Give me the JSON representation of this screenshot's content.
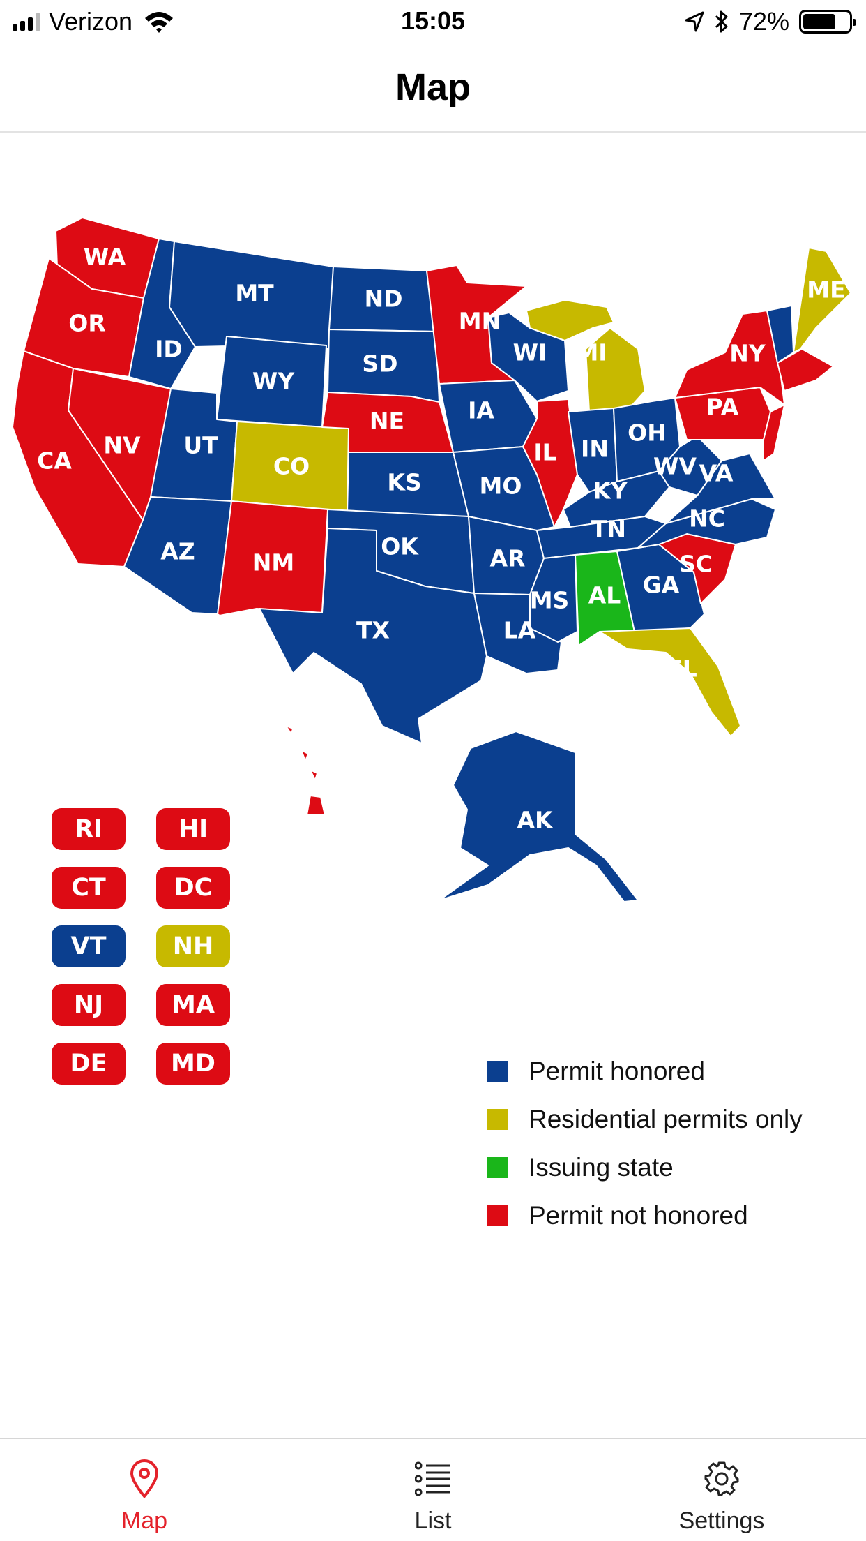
{
  "status_bar": {
    "carrier": "Verizon",
    "time": "15:05",
    "battery_percent": "72%",
    "battery_level": 0.72,
    "icons": [
      "signal-icon",
      "wifi-icon",
      "location-arrow-icon",
      "bluetooth-icon",
      "battery-icon"
    ]
  },
  "nav": {
    "title": "Map"
  },
  "colors": {
    "honored": "#0b3f8f",
    "residential": "#c7b900",
    "issuing": "#1ab61a",
    "not_honored": "#dd0b14",
    "tab_active": "#e4222b",
    "tab_inactive": "#222222"
  },
  "map": {
    "states": [
      {
        "abbr": "WA",
        "status": "not_honored"
      },
      {
        "abbr": "OR",
        "status": "not_honored"
      },
      {
        "abbr": "CA",
        "status": "not_honored"
      },
      {
        "abbr": "NV",
        "status": "not_honored"
      },
      {
        "abbr": "ID",
        "status": "honored"
      },
      {
        "abbr": "MT",
        "status": "honored"
      },
      {
        "abbr": "WY",
        "status": "honored"
      },
      {
        "abbr": "UT",
        "status": "honored"
      },
      {
        "abbr": "AZ",
        "status": "honored"
      },
      {
        "abbr": "CO",
        "status": "residential"
      },
      {
        "abbr": "NM",
        "status": "not_honored"
      },
      {
        "abbr": "ND",
        "status": "honored"
      },
      {
        "abbr": "SD",
        "status": "honored"
      },
      {
        "abbr": "NE",
        "status": "not_honored"
      },
      {
        "abbr": "KS",
        "status": "honored"
      },
      {
        "abbr": "OK",
        "status": "honored"
      },
      {
        "abbr": "TX",
        "status": "honored"
      },
      {
        "abbr": "MN",
        "status": "not_honored"
      },
      {
        "abbr": "IA",
        "status": "honored"
      },
      {
        "abbr": "MO",
        "status": "honored"
      },
      {
        "abbr": "AR",
        "status": "honored"
      },
      {
        "abbr": "LA",
        "status": "honored"
      },
      {
        "abbr": "WI",
        "status": "honored"
      },
      {
        "abbr": "MI",
        "status": "residential"
      },
      {
        "abbr": "IL",
        "status": "not_honored"
      },
      {
        "abbr": "IN",
        "status": "honored"
      },
      {
        "abbr": "OH",
        "status": "honored"
      },
      {
        "abbr": "KY",
        "status": "honored"
      },
      {
        "abbr": "TN",
        "status": "honored"
      },
      {
        "abbr": "MS",
        "status": "honored"
      },
      {
        "abbr": "AL",
        "status": "issuing"
      },
      {
        "abbr": "GA",
        "status": "honored"
      },
      {
        "abbr": "FL",
        "status": "residential"
      },
      {
        "abbr": "SC",
        "status": "not_honored"
      },
      {
        "abbr": "NC",
        "status": "honored"
      },
      {
        "abbr": "VA",
        "status": "honored"
      },
      {
        "abbr": "WV",
        "status": "honored"
      },
      {
        "abbr": "PA",
        "status": "not_honored"
      },
      {
        "abbr": "NY",
        "status": "not_honored"
      },
      {
        "abbr": "ME",
        "status": "residential"
      },
      {
        "abbr": "AK",
        "status": "honored"
      },
      {
        "abbr": "HI",
        "status": "not_honored"
      }
    ],
    "badges": [
      {
        "abbr": "RI",
        "status": "not_honored"
      },
      {
        "abbr": "HI",
        "status": "not_honored"
      },
      {
        "abbr": "CT",
        "status": "not_honored"
      },
      {
        "abbr": "DC",
        "status": "not_honored"
      },
      {
        "abbr": "VT",
        "status": "honored"
      },
      {
        "abbr": "NH",
        "status": "residential"
      },
      {
        "abbr": "NJ",
        "status": "not_honored"
      },
      {
        "abbr": "MA",
        "status": "not_honored"
      },
      {
        "abbr": "DE",
        "status": "not_honored"
      },
      {
        "abbr": "MD",
        "status": "not_honored"
      }
    ]
  },
  "legend": [
    {
      "key": "honored",
      "label": "Permit honored"
    },
    {
      "key": "residential",
      "label": "Residential permits only"
    },
    {
      "key": "issuing",
      "label": "Issuing state"
    },
    {
      "key": "not_honored",
      "label": "Permit not honored"
    }
  ],
  "tabs": [
    {
      "label": "Map",
      "icon": "map-pin-icon",
      "active": true
    },
    {
      "label": "List",
      "icon": "list-icon",
      "active": false
    },
    {
      "label": "Settings",
      "icon": "gear-icon",
      "active": false
    }
  ]
}
